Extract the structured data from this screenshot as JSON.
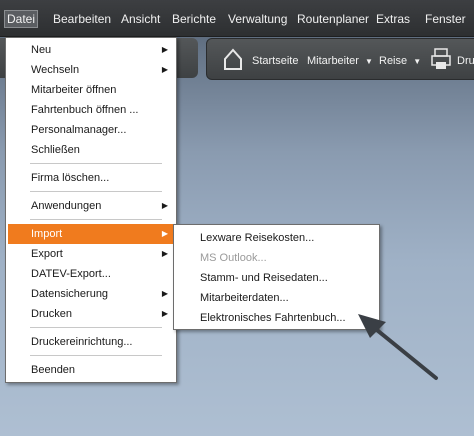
{
  "menubar": {
    "items": [
      {
        "label": "Datei"
      },
      {
        "label": "Bearbeiten"
      },
      {
        "label": "Ansicht"
      },
      {
        "label": "Berichte"
      },
      {
        "label": "Verwaltung"
      },
      {
        "label": "Routenplaner"
      },
      {
        "label": "Extras"
      },
      {
        "label": "Fenster"
      }
    ]
  },
  "toolbar": {
    "startseite": "Startseite",
    "mitarbeiter": "Mitarbeiter",
    "reise": "Reise",
    "drucken": "Dru"
  },
  "file_menu": {
    "items": [
      {
        "label": "Neu",
        "has_submenu": true
      },
      {
        "label": "Wechseln",
        "has_submenu": true
      },
      {
        "label": "Mitarbeiter öffnen"
      },
      {
        "label": "Fahrtenbuch öffnen ..."
      },
      {
        "label": "Personalmanager..."
      },
      {
        "label": "Schließen"
      },
      {
        "label": "Firma löschen..."
      },
      {
        "label": "Anwendungen",
        "has_submenu": true
      },
      {
        "label": "Import",
        "has_submenu": true,
        "highlighted": true
      },
      {
        "label": "Export",
        "has_submenu": true
      },
      {
        "label": "DATEV-Export..."
      },
      {
        "label": "Datensicherung",
        "has_submenu": true
      },
      {
        "label": "Drucken",
        "has_submenu": true
      },
      {
        "label": "Druckereinrichtung..."
      },
      {
        "label": "Beenden"
      }
    ]
  },
  "import_submenu": {
    "items": [
      {
        "label": "Lexware Reisekosten...",
        "disabled": false
      },
      {
        "label": "MS Outlook...",
        "disabled": true
      },
      {
        "label": "Stamm- und Reisedaten...",
        "disabled": false
      },
      {
        "label": "Mitarbeiterdaten...",
        "disabled": false
      },
      {
        "label": "Elektronisches Fahrtenbuch...",
        "disabled": false
      }
    ]
  },
  "colors": {
    "highlight": "#f07b1e",
    "menubar_bg": "#2d2f31",
    "annotation_arrow": "#3a3f45"
  },
  "icons": {
    "submenu_arrow": "triangle-right-icon",
    "home": "home-icon",
    "printer": "printer-icon",
    "dropdown": "caret-down-icon"
  }
}
